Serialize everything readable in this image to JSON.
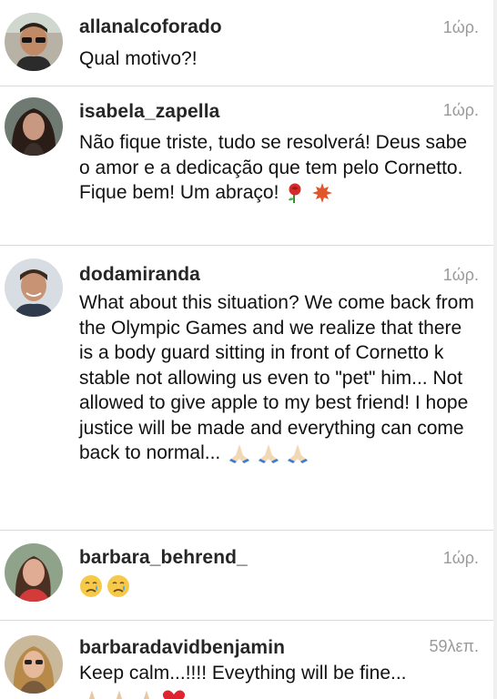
{
  "comments": [
    {
      "username": "allanalcoforado",
      "time": "1ώρ.",
      "text": "Qual motivo?!"
    },
    {
      "username": "isabela_zapella",
      "time": "1ώρ.",
      "text": "Não fique triste, tudo se resolverá! Deus sabe o amor e a dedicação que tem pelo Cornetto. Fique bem! Um abraço!",
      "emojis": [
        "rose-emoji",
        "maple-leaf-emoji"
      ]
    },
    {
      "username": "dodamiranda",
      "time": "1ώρ.",
      "text": "What about this situation? We come back from the Olympic Games and we realize that there is a body guard sitting in front of Cornetto k stable not allowing us even to \"pet\" him... Not allowed to give apple to my best friend! I hope justice will be made and everything can come back to normal...",
      "emojis": [
        "folded-hands-emoji",
        "folded-hands-emoji",
        "folded-hands-emoji"
      ]
    },
    {
      "username": "barbara_behrend_",
      "time": "1ώρ.",
      "text": "",
      "emojis": [
        "crying-face-emoji",
        "crying-face-emoji"
      ]
    },
    {
      "username": "barbaradavidbenjamin",
      "time": "59λεπ.",
      "text": "Keep calm...!!!! Eveything will be fine...",
      "emojis": [
        "folded-hands-emoji",
        "folded-hands-emoji",
        "folded-hands-emoji",
        "heart-emoji"
      ]
    }
  ],
  "colors": {
    "username": "#262626",
    "text": "#111111",
    "timestamp": "#9a9a9a",
    "divider": "#dbdbdb"
  }
}
